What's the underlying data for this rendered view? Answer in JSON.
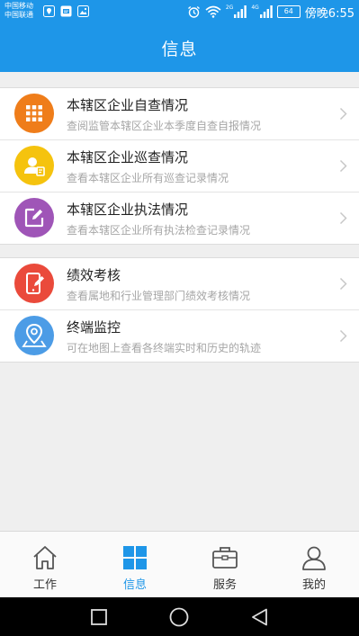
{
  "status_bar": {
    "carrier_1": "中国移动",
    "carrier_2": "中国联通",
    "network_2": "2G",
    "network_4": "4G",
    "battery": "64",
    "time": "傍晚6:55",
    "icons": [
      "location-icon",
      "notification-icon",
      "image-icon",
      "alarm-icon",
      "wifi-icon",
      "signal-icon",
      "battery-icon"
    ]
  },
  "header": {
    "title": "信息"
  },
  "groups": [
    {
      "items": [
        {
          "title": "本辖区企业自查情况",
          "subtitle": "查阅监管本辖区企业本季度自查自报情况",
          "icon": "grid-icon",
          "color": "#ef7d1a"
        },
        {
          "title": "本辖区企业巡查情况",
          "subtitle": "查看本辖区企业所有巡查记录情况",
          "icon": "inspector-icon",
          "color": "#f5c30e"
        },
        {
          "title": "本辖区企业执法情况",
          "subtitle": "查看本辖区企业所有执法检查记录情况",
          "icon": "edit-icon",
          "color": "#9f55b7"
        }
      ]
    },
    {
      "items": [
        {
          "title": "绩效考核",
          "subtitle": "查看属地和行业管理部门绩效考核情况",
          "icon": "phone-edit-icon",
          "color": "#ea4a3b"
        },
        {
          "title": "终端监控",
          "subtitle": "可在地图上查看各终端实时和历史的轨迹",
          "icon": "map-pin-icon",
          "color": "#4c9ce6"
        }
      ]
    }
  ],
  "tabs": [
    {
      "label": "工作",
      "icon": "home-icon",
      "active": false
    },
    {
      "label": "信息",
      "icon": "windows-grid-icon",
      "active": true
    },
    {
      "label": "服务",
      "icon": "toolbox-icon",
      "active": false
    },
    {
      "label": "我的",
      "icon": "user-icon",
      "active": false
    }
  ],
  "colors": {
    "accent": "#1e96e8",
    "background": "#efefef"
  }
}
